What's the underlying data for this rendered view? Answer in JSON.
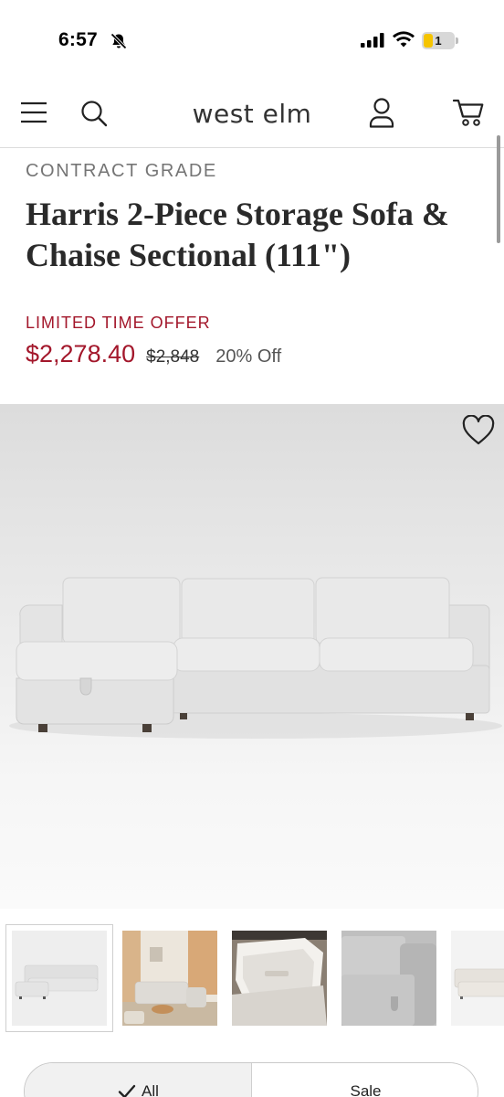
{
  "status_bar": {
    "time": "6:57",
    "battery_level": "1",
    "icons": [
      "bell-slash-icon",
      "cellular-signal-icon",
      "wifi-icon",
      "battery-icon"
    ]
  },
  "header": {
    "brand": "west elm",
    "icons": [
      "menu-icon",
      "search-icon",
      "account-icon",
      "cart-icon"
    ]
  },
  "product": {
    "eyebrow": "CONTRACT GRADE",
    "title": "Harris 2-Piece Storage Sofa & Chaise Sectional (111\")",
    "offer_label": "LIMITED TIME OFFER",
    "sale_price": "$2,278.40",
    "original_price": "$2,848",
    "discount": "20% Off"
  },
  "gallery": {
    "favorite_icon": "heart-outline-icon",
    "thumbnail_count_visible": 5,
    "selected_index": 0
  },
  "filters": {
    "options": [
      {
        "label": "All",
        "selected": true
      },
      {
        "label": "Sale",
        "selected": false
      }
    ]
  },
  "colors": {
    "sale_red": "#a3172b",
    "sofa_fabric": "#e8e8e8",
    "divider": "#dcdcdc"
  }
}
